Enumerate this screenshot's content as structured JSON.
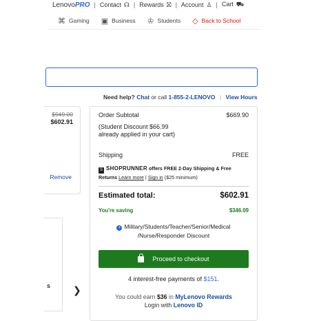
{
  "topnav": {
    "brand_prefix": "Lenovo",
    "brand_suffix": "PRO",
    "contact": "Contact",
    "rewards": "Rewards",
    "account": "Account",
    "cart": "Cart"
  },
  "catnav": {
    "gaming": "Gaming",
    "business": "Business",
    "students": "Students",
    "back_to_school": "Back to School"
  },
  "search": {
    "placeholder": ""
  },
  "help": {
    "need_help": "Need help?",
    "chat": "Chat",
    "or_call": "or call",
    "phone": "1-855-2-LENOVO",
    "view_hours": "View Hours"
  },
  "cart_item": {
    "original_price": "$949.00",
    "price": "$602.91",
    "remove": "Remove",
    "s_label": "s"
  },
  "summary": {
    "order_subtotal_label": "Order Subtotal",
    "order_subtotal_value": "$669.90",
    "student_discount_note": "(Student Discount $66.99 already applied in your cart)",
    "shipping_label": "Shipping",
    "shipping_value": "FREE",
    "shoprunner_name": "SHOPRUNNER",
    "shoprunner_offer": "offers FREE 2-Day Shipping & Free Returns",
    "learn_more": "Learn more",
    "sign_in": "Sign in",
    "shoprunner_min": "($25 minimum)",
    "estimated_total_label": "Estimated total:",
    "estimated_total_value": "$602.91",
    "saving_label": "You're saving",
    "saving_value": "$346.09",
    "discount_type": "Military/Students/Teacher/Senior/Medical /Nurse/Responder Discount",
    "checkout_label": "Proceed to checkout",
    "interest_text": "4 interest-free payments of",
    "interest_amount": "$151",
    "interest_end": ".",
    "earn_prefix": "You could earn",
    "earn_amount": "$36",
    "earn_in": "in",
    "rewards_link": "MyLenovo Rewards",
    "login_text": "Login with",
    "lenovo_id": "Lenovo ID"
  },
  "colors": {
    "accent_blue": "#2a6ad1",
    "link_blue": "#1a4fa0",
    "checkout_green": "#1e7a1e",
    "saving_green": "#1f7a1f",
    "back_to_school_red": "#dd1111"
  },
  "icons": {
    "contact": "headset-icon",
    "rewards": "gift-icon",
    "account": "user-icon",
    "cart": "cart-icon",
    "gaming": "gamepad-icon",
    "business": "briefcase-icon",
    "students": "graduation-cap-icon",
    "back_to_school": "tag-icon",
    "checkout": "lock-icon",
    "next": "chevron-right-icon"
  }
}
